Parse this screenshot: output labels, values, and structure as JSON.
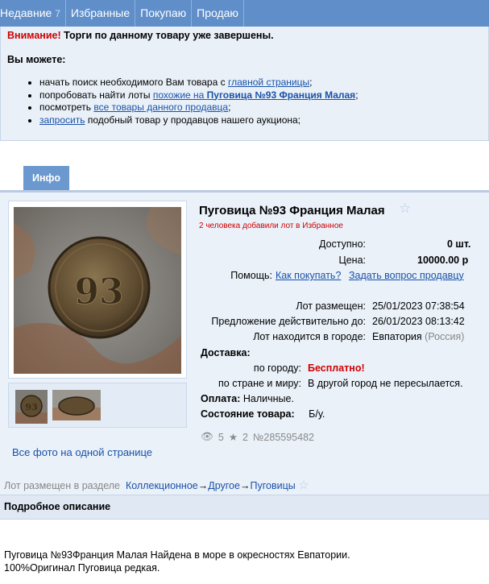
{
  "nav": {
    "tabs": [
      {
        "label": "Недавние",
        "count": "7"
      },
      {
        "label": "Избранные"
      },
      {
        "label": "Покупаю"
      },
      {
        "label": "Продаю"
      }
    ]
  },
  "notice": {
    "warn_prefix": "Внимание!",
    "warn_text": "Торги по данному товару уже завершены.",
    "you_can": "Вы можете:",
    "items": [
      {
        "pre": "начать поиск необходимого Вам товара с ",
        "link": "главной страницы",
        "post": ";"
      },
      {
        "pre": "попробовать найти лоты ",
        "link": "похожие на ",
        "link_bold": "Пуговица №93 Франция Малая",
        "post": ";"
      },
      {
        "pre": "посмотреть ",
        "link": "все товары данного продавца",
        "post": ";"
      },
      {
        "pre": "",
        "link": "запросить",
        "post": " подобный товар у продавцов нашего аукциона;"
      }
    ]
  },
  "tab_info": "Инфо",
  "lot": {
    "title": "Пуговица №93 Франция Малая",
    "favorites_note": "2 человека добавили лот в Избранное",
    "available_label": "Доступно:",
    "available_value": "0 шт.",
    "price_label": "Цена:",
    "price_value": "10000.00 р",
    "help_label": "Помощь:",
    "help_link1": "Как покупать?",
    "help_link2": "Задать вопрос продавцу",
    "placed_label": "Лот размещен:",
    "placed_value": "25/01/2023 07:38:54",
    "valid_label": "Предложение действительно до:",
    "valid_value": "26/01/2023 08:13:42",
    "city_label": "Лот находится в городе:",
    "city_value": "Евпатория",
    "country_value": "(Россия)",
    "delivery_label": "Доставка:",
    "city_delivery_label": "по городу:",
    "city_delivery_value": "Бесплатно!",
    "world_delivery_label": "по стране и миру:",
    "world_delivery_value": "В другой город не пересылается.",
    "payment_label": "Оплата:",
    "payment_value": "Наличные.",
    "condition_label": "Состояние товара:",
    "condition_value": "Б/у.",
    "views": "5",
    "stars": "2",
    "lot_number": "№285595482",
    "all_photos": "Все фото на одной странице"
  },
  "category": {
    "label": "Лот размещен в разделе",
    "path": [
      "Коллекционное",
      "Другое",
      "Пуговицы"
    ]
  },
  "description": {
    "heading": "Подробное описание",
    "line1": "Пуговица №93Франция Малая Найдена в море в окресностях Евпатории.",
    "line2": "100%Оригинал Пуговица редкая."
  },
  "icons": [
    "star-icon",
    "eye-icon",
    "star-count-icon"
  ],
  "colors": {
    "nav": "#5f8ec9",
    "panel": "#eaf1f9",
    "link": "#1a52a8",
    "alert": "#d00000"
  }
}
